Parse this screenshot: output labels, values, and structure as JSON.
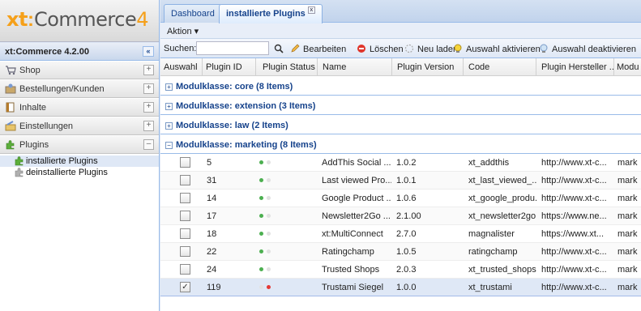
{
  "app": {
    "logo_xt": "xt",
    "logo_colon": ":",
    "logo_commerce": "Commerce",
    "logo_version": "4",
    "version_header": "xt:Commerce 4.2.00",
    "collapse_label": "«"
  },
  "sidebar": {
    "sections": [
      {
        "label": "Shop",
        "icon": "cart-icon",
        "toggle": "+"
      },
      {
        "label": "Bestellungen/Kunden",
        "icon": "orders-icon",
        "toggle": "+"
      },
      {
        "label": "Inhalte",
        "icon": "content-icon",
        "toggle": "+"
      },
      {
        "label": "Einstellungen",
        "icon": "settings-icon",
        "toggle": "+"
      },
      {
        "label": "Plugins",
        "icon": "plugin-icon",
        "toggle": "–"
      }
    ],
    "plugin_items": [
      {
        "label": "installierte Plugins",
        "icon": "plugin-installed-icon"
      },
      {
        "label": "deinstallierte Plugins",
        "icon": "plugin-uninstalled-icon"
      }
    ]
  },
  "tabs": [
    {
      "label": "Dashboard"
    },
    {
      "label": "installierte Plugins",
      "close": "x"
    }
  ],
  "menu": {
    "label": "Aktion ▾"
  },
  "toolbar": {
    "search_label": "Suchen:",
    "search_value": "",
    "edit": "Bearbeiten",
    "delete": "Löschen",
    "reload": "Neu laden",
    "activate": "Auswahl aktivieren",
    "deactivate": "Auswahl deaktivieren"
  },
  "columns": [
    "Auswahl",
    "Plugin ID",
    "Plugin Status",
    "Name",
    "Plugin Version",
    "Code",
    "Plugin Hersteller ...",
    "Modu"
  ],
  "groups": [
    {
      "label": "Modulklasse: core (8 Items)",
      "toggle": "+"
    },
    {
      "label": "Modulklasse: extension (3 Items)",
      "toggle": "+"
    },
    {
      "label": "Modulklasse: law (2 Items)",
      "toggle": "+"
    },
    {
      "label": "Modulklasse: marketing (8 Items)",
      "toggle": "−"
    }
  ],
  "rows": [
    {
      "checked": "",
      "id": "5",
      "name": "AddThis Social ...",
      "version": "1.0.2",
      "code": "xt_addthis",
      "vendor": "http://www.xt-c...",
      "mod": "mark",
      "status": "green"
    },
    {
      "checked": "",
      "id": "31",
      "name": "Last viewed Pro...",
      "version": "1.0.1",
      "code": "xt_last_viewed_...",
      "vendor": "http://www.xt-c...",
      "mod": "mark",
      "status": "green"
    },
    {
      "checked": "",
      "id": "14",
      "name": "Google Product ...",
      "version": "1.0.6",
      "code": "xt_google_produ...",
      "vendor": "http://www.xt-c...",
      "mod": "mark",
      "status": "green"
    },
    {
      "checked": "",
      "id": "17",
      "name": "Newsletter2Go ...",
      "version": "2.1.00",
      "code": "xt_newsletter2go",
      "vendor": "https://www.ne...",
      "mod": "mark",
      "status": "green"
    },
    {
      "checked": "",
      "id": "18",
      "name": "xt:MultiConnect",
      "version": "2.7.0",
      "code": "magnalister",
      "vendor": "https://www.xt...",
      "mod": "mark",
      "status": "green"
    },
    {
      "checked": "",
      "id": "22",
      "name": "Ratingchamp",
      "version": "1.0.5",
      "code": "ratingchamp",
      "vendor": "http://www.xt-c...",
      "mod": "mark",
      "status": "green"
    },
    {
      "checked": "",
      "id": "24",
      "name": "Trusted Shops",
      "version": "2.0.3",
      "code": "xt_trusted_shops",
      "vendor": "http://www.xt-c...",
      "mod": "mark",
      "status": "green"
    },
    {
      "checked": "✓",
      "id": "119",
      "name": "Trustami Siegel",
      "version": "1.0.0",
      "code": "xt_trustami",
      "vendor": "http://www.xt-c...",
      "mod": "mark",
      "status": "red"
    }
  ],
  "colors": {
    "accent": "#f5a01a",
    "header_blue": "#15428b",
    "status_green": "#4caf50",
    "status_red": "#e53935"
  }
}
